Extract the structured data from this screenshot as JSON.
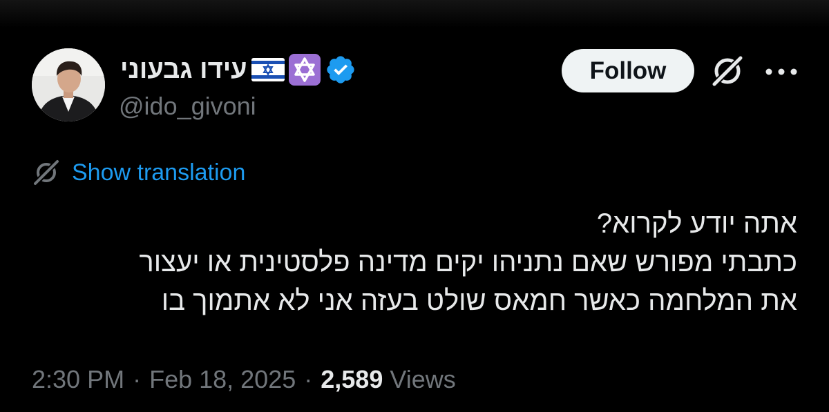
{
  "colors": {
    "background": "#000000",
    "primary_text": "#e7e9ea",
    "secondary_text": "#71767b",
    "link": "#1d9bf0",
    "verified_badge": "#1d9bf0",
    "follow_button_bg": "#eff3f4",
    "star_emoji_bg": "#9b6fd4"
  },
  "author": {
    "display_name": "עידו גבעוני",
    "handle": "@ido_givoni",
    "icons": [
      "israel-flag-icon",
      "star-of-david-icon",
      "verified-badge-icon"
    ]
  },
  "header_actions": {
    "follow_label": "Follow",
    "grok_icon": "grok-icon",
    "more_icon": "more-icon"
  },
  "translation": {
    "label": "Show translation",
    "icon": "translate-icon"
  },
  "tweet": {
    "lines": [
      "אתה יודע לקרוא?",
      "כתבתי מפורש שאם נתניהו יקים מדינה פלסטינית או יעצור",
      "את המלחמה כאשר חמאס שולט בעזה אני לא אתמוך בו"
    ]
  },
  "meta": {
    "time": "2:30 PM",
    "separator": "·",
    "date": "Feb 18, 2025",
    "views_count": "2,589",
    "views_label": "Views"
  }
}
